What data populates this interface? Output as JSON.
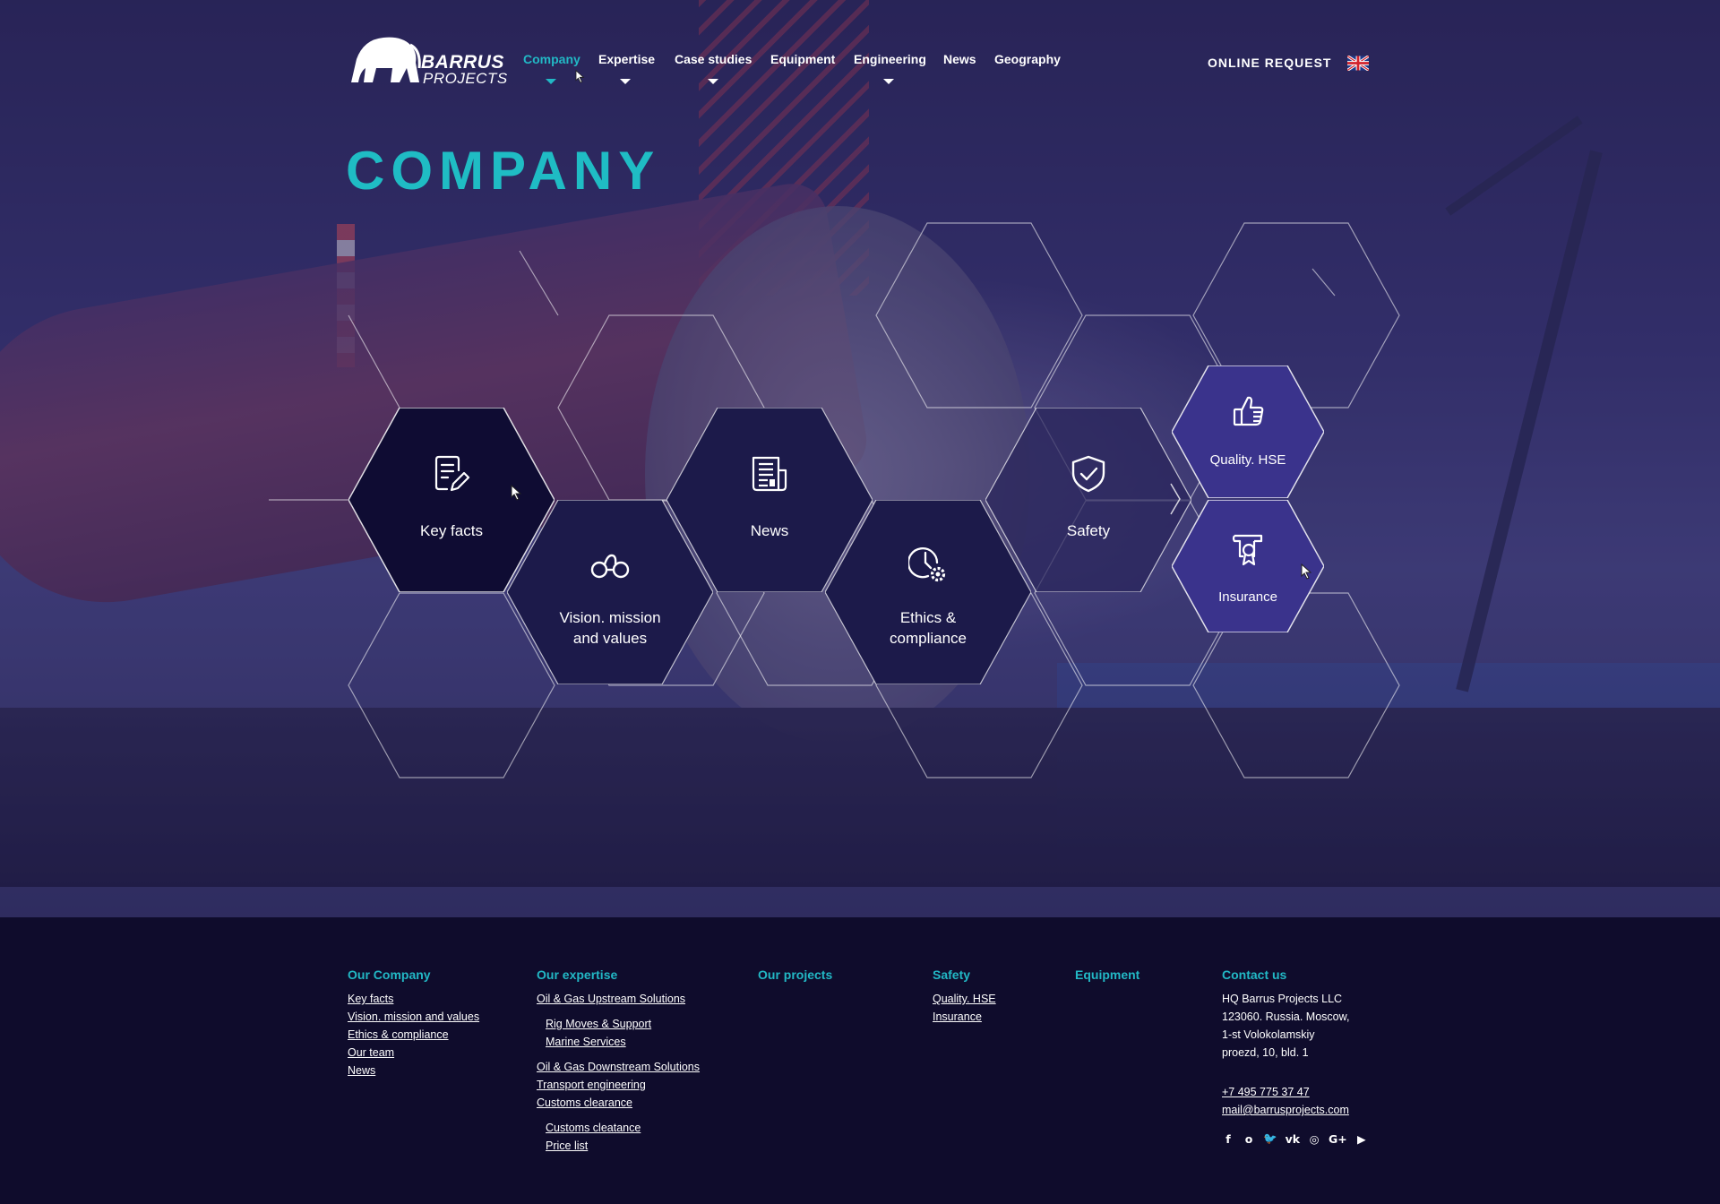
{
  "header": {
    "logo_line1": "BARRUS",
    "logo_line2": "PROJECTS",
    "nav": [
      {
        "label": "Company",
        "active": true,
        "has_dropdown": true
      },
      {
        "label": "Expertise",
        "active": false,
        "has_dropdown": true
      },
      {
        "label": "Case studies",
        "active": false,
        "has_dropdown": true
      },
      {
        "label": "Equipment",
        "active": false,
        "has_dropdown": false
      },
      {
        "label": "Engineering",
        "active": false,
        "has_dropdown": true
      },
      {
        "label": "News",
        "active": false,
        "has_dropdown": false
      },
      {
        "label": "Geography",
        "active": false,
        "has_dropdown": false
      }
    ],
    "online_request": "ONLINE REQUEST",
    "language_icon": "uk-flag-icon"
  },
  "page": {
    "title": "COMPANY"
  },
  "tiles": [
    {
      "id": "key-facts",
      "line1": "Key facts",
      "line2": "",
      "icon": "document-edit-icon"
    },
    {
      "id": "vision",
      "line1": "Vision. mission",
      "line2": "and values",
      "icon": "binoculars-icon"
    },
    {
      "id": "news",
      "line1": "News",
      "line2": "",
      "icon": "newspaper-icon"
    },
    {
      "id": "ethics",
      "line1": "Ethics &",
      "line2": "compliance",
      "icon": "clock-gear-icon"
    },
    {
      "id": "safety",
      "line1": "Safety",
      "line2": "",
      "icon": "shield-check-icon"
    },
    {
      "id": "quality",
      "line1": "Quality. HSE",
      "line2": "",
      "icon": "thumbs-up-icon"
    },
    {
      "id": "insurance",
      "line1": "Insurance",
      "line2": "",
      "icon": "certificate-icon"
    }
  ],
  "footer": {
    "our_company": {
      "heading": "Our Company",
      "links": [
        "Key facts",
        "Vision. mission and values",
        "Ethics & compliance",
        "Our team",
        "News"
      ]
    },
    "our_expertise": {
      "heading": "Our expertise",
      "links": [
        "Oil & Gas Upstream Solutions",
        "Rig Moves & Support",
        "Marine Services",
        "Oil & Gas Downstream Solutions",
        "Transport engineering",
        "Customs clearance",
        "Customs cleatance",
        "Price list"
      ]
    },
    "our_projects": {
      "heading": "Our projects"
    },
    "safety": {
      "heading": "Safety",
      "links": [
        "Quality. HSE",
        "Insurance"
      ]
    },
    "equipment": {
      "heading": "Equipment"
    },
    "contact": {
      "heading": "Contact us",
      "address_lines": [
        "HQ Barrus Projects LLC",
        "123060. Russia. Moscow,",
        "1-st Volokolamskiy",
        "proezd, 10, bld. 1"
      ],
      "phone": "+7 495 775 37 47",
      "email": "mail@barrusprojects.com",
      "social": [
        {
          "icon": "facebook-icon",
          "glyph": "f"
        },
        {
          "icon": "odnoklassniki-icon",
          "glyph": "ᴏ"
        },
        {
          "icon": "twitter-icon",
          "glyph": "🐦"
        },
        {
          "icon": "vk-icon",
          "glyph": "vk"
        },
        {
          "icon": "instagram-icon",
          "glyph": "◎"
        },
        {
          "icon": "google-plus-icon",
          "glyph": "G+"
        },
        {
          "icon": "youtube-icon",
          "glyph": "▶"
        }
      ]
    }
  },
  "colors": {
    "accent": "#22b8c5",
    "footer_bg": "#0f0c2c",
    "tile_dark": "#0f0c33",
    "tile_navy": "#1c1a4a",
    "tile_highlight": "#3a338c"
  }
}
